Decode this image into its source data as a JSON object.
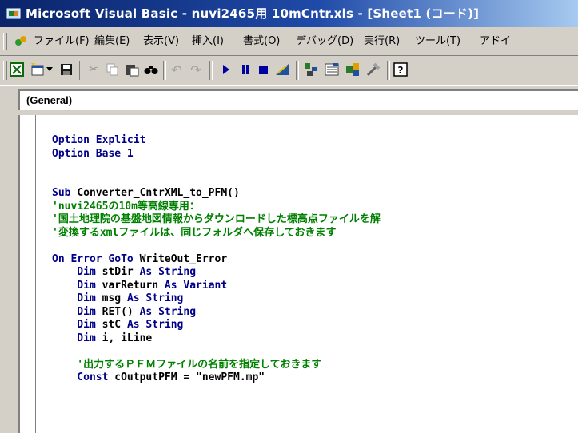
{
  "window": {
    "title": "Microsoft Visual Basic - nuvi2465用 10mCntr.xls - [Sheet1 (コード)]"
  },
  "menu": [
    "ファイル(F)",
    "編集(E)",
    "表示(V)",
    "挿入(I)",
    "書式(O)",
    "デバッグ(D)",
    "実行(R)",
    "ツール(T)",
    "アドイ"
  ],
  "toolbar": {
    "buttons": [
      "view-excel-icon",
      "insert-userform-icon",
      "dropdown-arrow-icon",
      "save-icon",
      "cut-icon",
      "copy-icon",
      "paste-icon",
      "find-icon",
      "undo-icon",
      "redo-icon",
      "run-icon",
      "break-icon",
      "reset-icon",
      "design-mode-icon",
      "project-explorer-icon",
      "properties-icon",
      "object-browser-icon",
      "toolbox-icon",
      "help-icon"
    ]
  },
  "procedure_combo": {
    "value": "(General)"
  },
  "code": {
    "lines": [
      [
        {
          "t": "Option Explicit",
          "c": "kw"
        }
      ],
      [
        {
          "t": "Option Base 1",
          "c": "kw"
        }
      ],
      [],
      [],
      [
        {
          "t": "Sub ",
          "c": "kw"
        },
        {
          "t": "Converter_CntrXML_to_PFM()",
          "c": "id"
        }
      ],
      [
        {
          "t": "'nuvi2465の10m等高線専用：",
          "c": "cm"
        }
      ],
      [
        {
          "t": "'国土地理院の基盤地図情報からダウンロードした標高点ファイルを解",
          "c": "cm"
        }
      ],
      [
        {
          "t": "'変換するxmlファイルは、同じフォルダへ保存しておきます",
          "c": "cm"
        }
      ],
      [],
      [
        {
          "t": "On Error GoTo ",
          "c": "kw"
        },
        {
          "t": "WriteOut_Error",
          "c": "id"
        }
      ],
      [
        {
          "t": "    Dim ",
          "c": "kw"
        },
        {
          "t": "stDir ",
          "c": "id"
        },
        {
          "t": "As String",
          "c": "kw"
        }
      ],
      [
        {
          "t": "    Dim ",
          "c": "kw"
        },
        {
          "t": "varReturn ",
          "c": "id"
        },
        {
          "t": "As Variant",
          "c": "kw"
        }
      ],
      [
        {
          "t": "    Dim ",
          "c": "kw"
        },
        {
          "t": "msg ",
          "c": "id"
        },
        {
          "t": "As String",
          "c": "kw"
        }
      ],
      [
        {
          "t": "    Dim ",
          "c": "kw"
        },
        {
          "t": "RET() ",
          "c": "id"
        },
        {
          "t": "As String",
          "c": "kw"
        }
      ],
      [
        {
          "t": "    Dim ",
          "c": "kw"
        },
        {
          "t": "stC ",
          "c": "id"
        },
        {
          "t": "As String",
          "c": "kw"
        }
      ],
      [
        {
          "t": "    Dim ",
          "c": "kw"
        },
        {
          "t": "i, iLine",
          "c": "id"
        }
      ],
      [],
      [
        {
          "t": "    '出力するＰＦＭファイルの名前を指定しておきます",
          "c": "cm"
        }
      ],
      [
        {
          "t": "    Const ",
          "c": "kw"
        },
        {
          "t": "cOutputPFM = \"newPFM.mp\"",
          "c": "id"
        }
      ]
    ]
  }
}
